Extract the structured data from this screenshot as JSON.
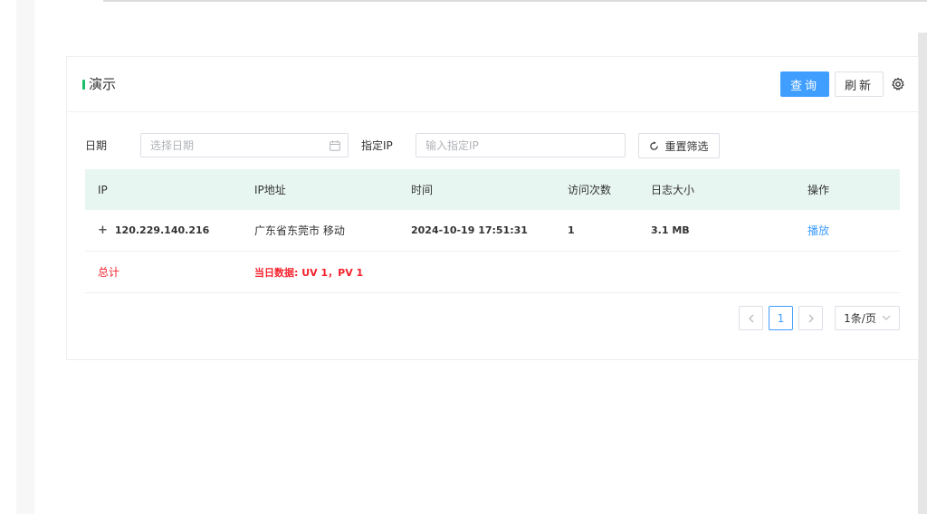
{
  "card": {
    "title": "演示",
    "query_label": "查询",
    "refresh_label": "刷新",
    "accent_color": "#19be6b",
    "primary_color": "#409eff"
  },
  "filters": {
    "date_label": "日期",
    "date_placeholder": "选择日期",
    "ip_label": "指定IP",
    "ip_placeholder": "输入指定IP",
    "reset_label": "重置筛选"
  },
  "table": {
    "headers": [
      "IP",
      "IP地址",
      "时间",
      "访问次数",
      "日志大小",
      "操作"
    ],
    "rows": [
      {
        "ip": "120.229.140.216",
        "location": "广东省东莞市 移动",
        "time": "2024-10-19 17:51:31",
        "visits": "1",
        "size": "3.1 MB",
        "action": "播放"
      }
    ],
    "summary": {
      "label": "总计",
      "text": "当日数据: UV 1，PV 1"
    }
  },
  "pagination": {
    "current_page": "1",
    "page_size": "1条/页"
  },
  "icons": {
    "settings": "gear-icon",
    "calendar": "calendar-icon",
    "reset": "refresh-icon",
    "expand": "plus-icon",
    "prev": "chevron-left-icon",
    "next": "chevron-right-icon",
    "dropdown": "chevron-down-icon"
  }
}
